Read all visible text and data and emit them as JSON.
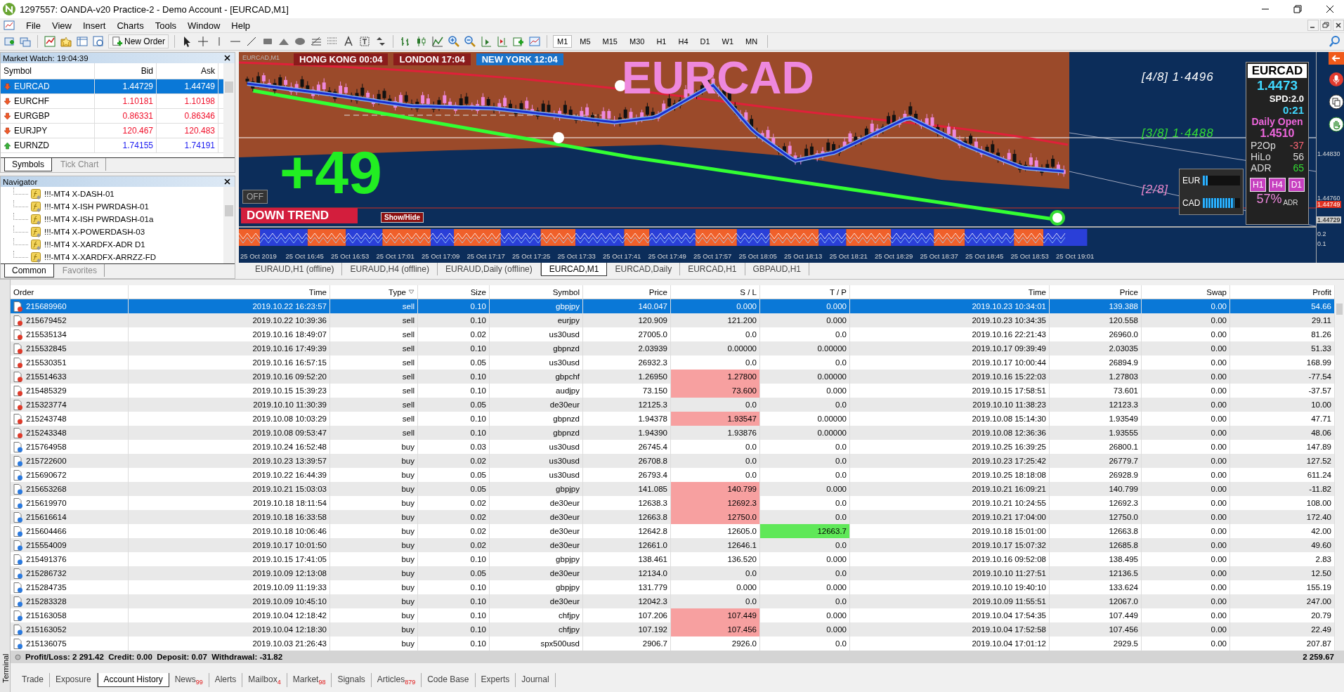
{
  "window": {
    "title": "1297557: OANDA-v20 Practice-2 - Demo Account - [EURCAD,M1]"
  },
  "menu": [
    "File",
    "View",
    "Insert",
    "Charts",
    "Tools",
    "Window",
    "Help"
  ],
  "toolbar": {
    "new_order": "New Order",
    "timeframes": [
      {
        "label": "M1",
        "selected": true
      },
      {
        "label": "M5",
        "selected": false
      },
      {
        "label": "M15",
        "selected": false
      },
      {
        "label": "M30",
        "selected": false
      },
      {
        "label": "H1",
        "selected": false
      },
      {
        "label": "H4",
        "selected": false
      },
      {
        "label": "D1",
        "selected": false
      },
      {
        "label": "W1",
        "selected": false
      },
      {
        "label": "MN",
        "selected": false
      }
    ]
  },
  "market_watch": {
    "title": "Market Watch: 19:04:39",
    "columns": [
      "Symbol",
      "Bid",
      "Ask"
    ],
    "rows": [
      {
        "symbol": "EURCAD",
        "bid": "1.44729",
        "ask": "1.44749",
        "falling": true,
        "selected": true
      },
      {
        "symbol": "EURCHF",
        "bid": "1.10181",
        "ask": "1.10198",
        "falling": true,
        "selected": false
      },
      {
        "symbol": "EURGBP",
        "bid": "0.86331",
        "ask": "0.86346",
        "falling": true,
        "selected": false
      },
      {
        "symbol": "EURJPY",
        "bid": "120.467",
        "ask": "120.483",
        "falling": true,
        "selected": false
      },
      {
        "symbol": "EURNZD",
        "bid": "1.74155",
        "ask": "1.74191",
        "falling": false,
        "selected": false
      }
    ],
    "tabs": [
      {
        "label": "Symbols",
        "selected": true
      },
      {
        "label": "Tick Chart",
        "selected": false
      }
    ]
  },
  "navigator": {
    "title": "Navigator",
    "items": [
      "!!!-MT4 X-DASH-01",
      "!!!-MT4 X-ISH PWRDASH-01",
      "!!!-MT4 X-ISH PWRDASH-01a",
      "!!!-MT4 X-POWERDASH-03",
      "!!!-MT4 X-XARDFX-ADR D1",
      "!!!-MT4 X-XARDFX-ARRZZ-FD"
    ],
    "tabs": [
      {
        "label": "Common",
        "selected": true
      },
      {
        "label": "Favorites",
        "selected": false
      }
    ]
  },
  "chart": {
    "label": "EURCAD,M1",
    "sessions": [
      {
        "label": "HONG KONG 00:04",
        "color": "#8b1c1c"
      },
      {
        "label": "LONDON 17:04",
        "color": "#8b1c1c"
      },
      {
        "label": "NEW YORK 12:04",
        "color": "#1a72c8"
      }
    ],
    "symbol_title": "EURCAD",
    "pips": "+49",
    "off_button": "OFF",
    "trend": "DOWN TREND",
    "show_hide": "Show/Hide",
    "levels": [
      {
        "label": "[4/8] 1·4496",
        "color": "#ffffff"
      },
      {
        "label": "[3/8] 1·4488",
        "color": "#33dd33"
      },
      {
        "label": "[2/8]",
        "color": "#ee88cc"
      }
    ],
    "info_panel": {
      "symbol": "EURCAD",
      "price": "1.4473",
      "spread": "SPD:2.0",
      "timer": "0:21",
      "daily_open_label": "Daily Open",
      "daily_open": "1.4510",
      "stats": [
        {
          "label": "P2Op",
          "value": "-37",
          "color": "#ff6677"
        },
        {
          "label": "HiLo",
          "value": "56",
          "color": "#dddddd"
        },
        {
          "label": "ADR",
          "value": "65",
          "color": "#33dd33"
        }
      ],
      "timeframes": [
        "H1",
        "H4",
        "D1"
      ],
      "percent": "57%",
      "percent_label": "ADR"
    },
    "strength": [
      {
        "label": "EUR",
        "level": 0.15
      },
      {
        "label": "CAD",
        "level": 0.85
      }
    ],
    "price_axis": [
      {
        "value": "1.44830",
        "kind": "tick"
      },
      {
        "value": "1.44760",
        "kind": "tick"
      },
      {
        "value": "1.44749",
        "kind": "ask"
      },
      {
        "value": "1.44729",
        "kind": "bid"
      },
      {
        "value": "0.2",
        "kind": "tick"
      },
      {
        "value": "0.1",
        "kind": "tick"
      }
    ],
    "time_axis": [
      "25 Oct 2019",
      "25 Oct 16:45",
      "25 Oct 16:53",
      "25 Oct 17:01",
      "25 Oct 17:09",
      "25 Oct 17:17",
      "25 Oct 17:25",
      "25 Oct 17:33",
      "25 Oct 17:41",
      "25 Oct 17:49",
      "25 Oct 17:57",
      "25 Oct 18:05",
      "25 Oct 18:13",
      "25 Oct 18:21",
      "25 Oct 18:29",
      "25 Oct 18:37",
      "25 Oct 18:45",
      "25 Oct 18:53",
      "25 Oct 19:01"
    ]
  },
  "chart_tabs": [
    {
      "label": "EURAUD,H1 (offline)",
      "selected": false
    },
    {
      "label": "EURAUD,H4 (offline)",
      "selected": false
    },
    {
      "label": "EURAUD,Daily (offline)",
      "selected": false
    },
    {
      "label": "EURCAD,M1",
      "selected": true
    },
    {
      "label": "EURCAD,Daily",
      "selected": false
    },
    {
      "label": "EURCAD,H1",
      "selected": false
    },
    {
      "label": "GBPAUD,H1",
      "selected": false
    }
  ],
  "terminal": {
    "label": "Terminal",
    "columns": [
      "Order",
      "Time",
      "Type",
      "Size",
      "Symbol",
      "Price",
      "S / L",
      "T / P",
      "Time",
      "Price",
      "Swap",
      "Profit"
    ],
    "rows": [
      {
        "kind": "sell",
        "order": "215689960",
        "time": "2019.10.22 16:23:57",
        "type": "sell",
        "size": "0.10",
        "symbol": "gbpjpy",
        "price": "140.047",
        "sl": "0.000",
        "tp": "0.000",
        "close_time": "2019.10.23 10:34:01",
        "close_price": "139.388",
        "swap": "0.00",
        "profit": "54.66",
        "selected": true,
        "sl_hit": false,
        "tp_hit": false
      },
      {
        "kind": "sell",
        "order": "215679452",
        "time": "2019.10.22 10:39:36",
        "type": "sell",
        "size": "0.10",
        "symbol": "eurjpy",
        "price": "120.909",
        "sl": "121.200",
        "tp": "0.000",
        "close_time": "2019.10.23 10:34:35",
        "close_price": "120.558",
        "swap": "0.00",
        "profit": "29.11",
        "selected": false,
        "sl_hit": false,
        "tp_hit": false
      },
      {
        "kind": "sell",
        "order": "215535134",
        "time": "2019.10.16 18:49:07",
        "type": "sell",
        "size": "0.02",
        "symbol": "us30usd",
        "price": "27005.0",
        "sl": "0.0",
        "tp": "0.0",
        "close_time": "2019.10.16 22:21:43",
        "close_price": "26960.0",
        "swap": "0.00",
        "profit": "81.26",
        "selected": false,
        "sl_hit": false,
        "tp_hit": false
      },
      {
        "kind": "sell",
        "order": "215532845",
        "time": "2019.10.16 17:49:39",
        "type": "sell",
        "size": "0.10",
        "symbol": "gbpnzd",
        "price": "2.03939",
        "sl": "0.00000",
        "tp": "0.00000",
        "close_time": "2019.10.17 09:39:49",
        "close_price": "2.03035",
        "swap": "0.00",
        "profit": "51.33",
        "selected": false,
        "sl_hit": false,
        "tp_hit": false
      },
      {
        "kind": "sell",
        "order": "215530351",
        "time": "2019.10.16 16:57:15",
        "type": "sell",
        "size": "0.05",
        "symbol": "us30usd",
        "price": "26932.3",
        "sl": "0.0",
        "tp": "0.0",
        "close_time": "2019.10.17 10:00:44",
        "close_price": "26894.9",
        "swap": "0.00",
        "profit": "168.99",
        "selected": false,
        "sl_hit": false,
        "tp_hit": false
      },
      {
        "kind": "sell",
        "order": "215514633",
        "time": "2019.10.16 09:52:20",
        "type": "sell",
        "size": "0.10",
        "symbol": "gbpchf",
        "price": "1.26950",
        "sl": "1.27800",
        "tp": "0.00000",
        "close_time": "2019.10.16 15:22:03",
        "close_price": "1.27803",
        "swap": "0.00",
        "profit": "-77.54",
        "selected": false,
        "sl_hit": true,
        "tp_hit": false
      },
      {
        "kind": "sell",
        "order": "215485329",
        "time": "2019.10.15 15:39:23",
        "type": "sell",
        "size": "0.10",
        "symbol": "audjpy",
        "price": "73.150",
        "sl": "73.600",
        "tp": "0.000",
        "close_time": "2019.10.15 17:58:51",
        "close_price": "73.601",
        "swap": "0.00",
        "profit": "-37.57",
        "selected": false,
        "sl_hit": true,
        "tp_hit": false
      },
      {
        "kind": "sell",
        "order": "215323774",
        "time": "2019.10.10 11:30:39",
        "type": "sell",
        "size": "0.05",
        "symbol": "de30eur",
        "price": "12125.3",
        "sl": "0.0",
        "tp": "0.0",
        "close_time": "2019.10.10 11:38:23",
        "close_price": "12123.3",
        "swap": "0.00",
        "profit": "10.00",
        "selected": false,
        "sl_hit": false,
        "tp_hit": false
      },
      {
        "kind": "sell",
        "order": "215243748",
        "time": "2019.10.08 10:03:29",
        "type": "sell",
        "size": "0.10",
        "symbol": "gbpnzd",
        "price": "1.94378",
        "sl": "1.93547",
        "tp": "0.00000",
        "close_time": "2019.10.08 15:14:30",
        "close_price": "1.93549",
        "swap": "0.00",
        "profit": "47.71",
        "selected": false,
        "sl_hit": true,
        "tp_hit": false
      },
      {
        "kind": "sell",
        "order": "215243348",
        "time": "2019.10.08 09:53:47",
        "type": "sell",
        "size": "0.10",
        "symbol": "gbpnzd",
        "price": "1.94390",
        "sl": "1.93876",
        "tp": "0.00000",
        "close_time": "2019.10.08 12:36:36",
        "close_price": "1.93555",
        "swap": "0.00",
        "profit": "48.06",
        "selected": false,
        "sl_hit": false,
        "tp_hit": false
      },
      {
        "kind": "buy",
        "order": "215764958",
        "time": "2019.10.24 16:52:48",
        "type": "buy",
        "size": "0.03",
        "symbol": "us30usd",
        "price": "26745.4",
        "sl": "0.0",
        "tp": "0.0",
        "close_time": "2019.10.25 16:39:25",
        "close_price": "26800.1",
        "swap": "0.00",
        "profit": "147.89",
        "selected": false,
        "sl_hit": false,
        "tp_hit": false
      },
      {
        "kind": "buy",
        "order": "215722600",
        "time": "2019.10.23 13:39:57",
        "type": "buy",
        "size": "0.02",
        "symbol": "us30usd",
        "price": "26708.8",
        "sl": "0.0",
        "tp": "0.0",
        "close_time": "2019.10.23 17:25:42",
        "close_price": "26779.7",
        "swap": "0.00",
        "profit": "127.52",
        "selected": false,
        "sl_hit": false,
        "tp_hit": false
      },
      {
        "kind": "buy",
        "order": "215690672",
        "time": "2019.10.22 16:44:39",
        "type": "buy",
        "size": "0.05",
        "symbol": "us30usd",
        "price": "26793.4",
        "sl": "0.0",
        "tp": "0.0",
        "close_time": "2019.10.25 18:18:08",
        "close_price": "26928.9",
        "swap": "0.00",
        "profit": "611.24",
        "selected": false,
        "sl_hit": false,
        "tp_hit": false
      },
      {
        "kind": "buy",
        "order": "215653268",
        "time": "2019.10.21 15:03:03",
        "type": "buy",
        "size": "0.05",
        "symbol": "gbpjpy",
        "price": "141.085",
        "sl": "140.799",
        "tp": "0.000",
        "close_time": "2019.10.21 16:09:21",
        "close_price": "140.799",
        "swap": "0.00",
        "profit": "-11.82",
        "selected": false,
        "sl_hit": true,
        "tp_hit": false
      },
      {
        "kind": "buy",
        "order": "215619970",
        "time": "2019.10.18 18:11:54",
        "type": "buy",
        "size": "0.02",
        "symbol": "de30eur",
        "price": "12638.3",
        "sl": "12692.3",
        "tp": "0.0",
        "close_time": "2019.10.21 10:24:55",
        "close_price": "12692.3",
        "swap": "0.00",
        "profit": "108.00",
        "selected": false,
        "sl_hit": true,
        "tp_hit": false
      },
      {
        "kind": "buy",
        "order": "215616614",
        "time": "2019.10.18 16:33:58",
        "type": "buy",
        "size": "0.02",
        "symbol": "de30eur",
        "price": "12663.8",
        "sl": "12750.0",
        "tp": "0.0",
        "close_time": "2019.10.21 17:04:00",
        "close_price": "12750.0",
        "swap": "0.00",
        "profit": "172.40",
        "selected": false,
        "sl_hit": true,
        "tp_hit": false
      },
      {
        "kind": "buy",
        "order": "215604466",
        "time": "2019.10.18 10:06:46",
        "type": "buy",
        "size": "0.02",
        "symbol": "de30eur",
        "price": "12642.8",
        "sl": "12605.0",
        "tp": "12663.7",
        "close_time": "2019.10.18 15:01:00",
        "close_price": "12663.8",
        "swap": "0.00",
        "profit": "42.00",
        "selected": false,
        "sl_hit": false,
        "tp_hit": true
      },
      {
        "kind": "buy",
        "order": "215554009",
        "time": "2019.10.17 10:01:50",
        "type": "buy",
        "size": "0.02",
        "symbol": "de30eur",
        "price": "12661.0",
        "sl": "12646.1",
        "tp": "0.0",
        "close_time": "2019.10.17 15:07:32",
        "close_price": "12685.8",
        "swap": "0.00",
        "profit": "49.60",
        "selected": false,
        "sl_hit": false,
        "tp_hit": false
      },
      {
        "kind": "buy",
        "order": "215491376",
        "time": "2019.10.15 17:41:05",
        "type": "buy",
        "size": "0.10",
        "symbol": "gbpjpy",
        "price": "138.461",
        "sl": "136.520",
        "tp": "0.000",
        "close_time": "2019.10.16 09:52:08",
        "close_price": "138.495",
        "swap": "0.00",
        "profit": "2.83",
        "selected": false,
        "sl_hit": false,
        "tp_hit": false
      },
      {
        "kind": "buy",
        "order": "215286732",
        "time": "2019.10.09 12:13:08",
        "type": "buy",
        "size": "0.05",
        "symbol": "de30eur",
        "price": "12134.0",
        "sl": "0.0",
        "tp": "0.0",
        "close_time": "2019.10.10 11:27:51",
        "close_price": "12136.5",
        "swap": "0.00",
        "profit": "12.50",
        "selected": false,
        "sl_hit": false,
        "tp_hit": false
      },
      {
        "kind": "buy",
        "order": "215284735",
        "time": "2019.10.09 11:19:33",
        "type": "buy",
        "size": "0.10",
        "symbol": "gbpjpy",
        "price": "131.779",
        "sl": "0.000",
        "tp": "0.000",
        "close_time": "2019.10.10 19:40:10",
        "close_price": "133.624",
        "swap": "0.00",
        "profit": "155.19",
        "selected": false,
        "sl_hit": false,
        "tp_hit": false
      },
      {
        "kind": "buy",
        "order": "215283328",
        "time": "2019.10.09 10:45:10",
        "type": "buy",
        "size": "0.10",
        "symbol": "de30eur",
        "price": "12042.3",
        "sl": "0.0",
        "tp": "0.0",
        "close_time": "2019.10.09 11:55:51",
        "close_price": "12067.0",
        "swap": "0.00",
        "profit": "247.00",
        "selected": false,
        "sl_hit": false,
        "tp_hit": false
      },
      {
        "kind": "buy",
        "order": "215163058",
        "time": "2019.10.04 12:18:42",
        "type": "buy",
        "size": "0.10",
        "symbol": "chfjpy",
        "price": "107.206",
        "sl": "107.449",
        "tp": "0.000",
        "close_time": "2019.10.04 17:54:35",
        "close_price": "107.449",
        "swap": "0.00",
        "profit": "20.79",
        "selected": false,
        "sl_hit": true,
        "tp_hit": false
      },
      {
        "kind": "buy",
        "order": "215163052",
        "time": "2019.10.04 12:18:30",
        "type": "buy",
        "size": "0.10",
        "symbol": "chfjpy",
        "price": "107.192",
        "sl": "107.456",
        "tp": "0.000",
        "close_time": "2019.10.04 17:52:58",
        "close_price": "107.456",
        "swap": "0.00",
        "profit": "22.49",
        "selected": false,
        "sl_hit": true,
        "tp_hit": false
      },
      {
        "kind": "buy",
        "order": "215136075",
        "time": "2019.10.03 21:26:43",
        "type": "buy",
        "size": "0.10",
        "symbol": "spx500usd",
        "price": "2906.7",
        "sl": "2926.0",
        "tp": "0.0",
        "close_time": "2019.10.04 17:01:12",
        "close_price": "2929.5",
        "swap": "0.00",
        "profit": "207.87",
        "selected": false,
        "sl_hit": false,
        "tp_hit": false
      }
    ],
    "summary": "Profit/Loss: 2 291.42  Credit: 0.00  Deposit: 0.07  Withdrawal: -31.82",
    "total": "2 259.67",
    "tabs": [
      {
        "label": "Trade",
        "selected": false
      },
      {
        "label": "Exposure",
        "selected": false
      },
      {
        "label": "Account History",
        "selected": true
      },
      {
        "label": "News",
        "badge": "99",
        "selected": false
      },
      {
        "label": "Alerts",
        "selected": false
      },
      {
        "label": "Mailbox",
        "badge": "4",
        "selected": false
      },
      {
        "label": "Market",
        "badge": "98",
        "selected": false
      },
      {
        "label": "Signals",
        "selected": false
      },
      {
        "label": "Articles",
        "badge": "879",
        "selected": false
      },
      {
        "label": "Code Base",
        "selected": false
      },
      {
        "label": "Experts",
        "selected": false
      },
      {
        "label": "Journal",
        "selected": false
      }
    ]
  }
}
